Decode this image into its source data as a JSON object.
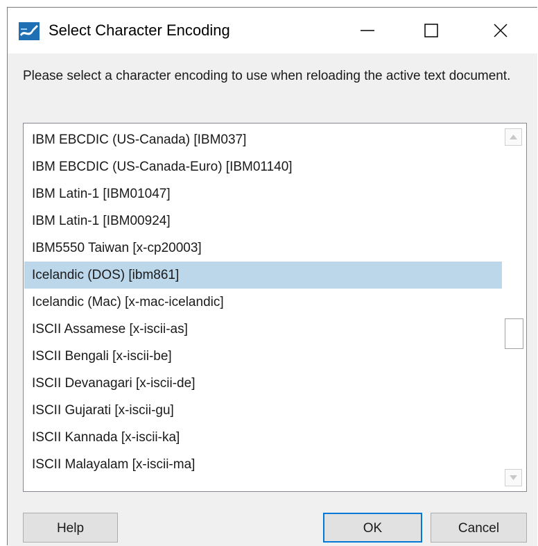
{
  "window": {
    "title": "Select Character Encoding",
    "icon": "app-logo-icon",
    "controls": {
      "minimize": "minimize-icon",
      "maximize": "maximize-icon",
      "close": "close-icon"
    }
  },
  "prompt": "Please select a character encoding to use when reloading the active text document.",
  "encodings": {
    "items": [
      "IBM EBCDIC (US-Canada) [IBM037]",
      "IBM EBCDIC (US-Canada-Euro) [IBM01140]",
      "IBM Latin-1 [IBM01047]",
      "IBM Latin-1 [IBM00924]",
      "IBM5550 Taiwan [x-cp20003]",
      "Icelandic (DOS) [ibm861]",
      "Icelandic (Mac) [x-mac-icelandic]",
      "ISCII Assamese [x-iscii-as]",
      "ISCII Bengali [x-iscii-be]",
      "ISCII Devanagari [x-iscii-de]",
      "ISCII Gujarati [x-iscii-gu]",
      "ISCII Kannada [x-iscii-ka]",
      "ISCII Malayalam [x-iscii-ma]"
    ],
    "selected": "Icelandic (DOS) [ibm861]"
  },
  "buttons": {
    "help": "Help",
    "ok": "OK",
    "cancel": "Cancel"
  },
  "colors": {
    "selection": "#bcd6ea",
    "default_button_border": "#0078d7",
    "dialog_background": "#f0f0f0"
  }
}
